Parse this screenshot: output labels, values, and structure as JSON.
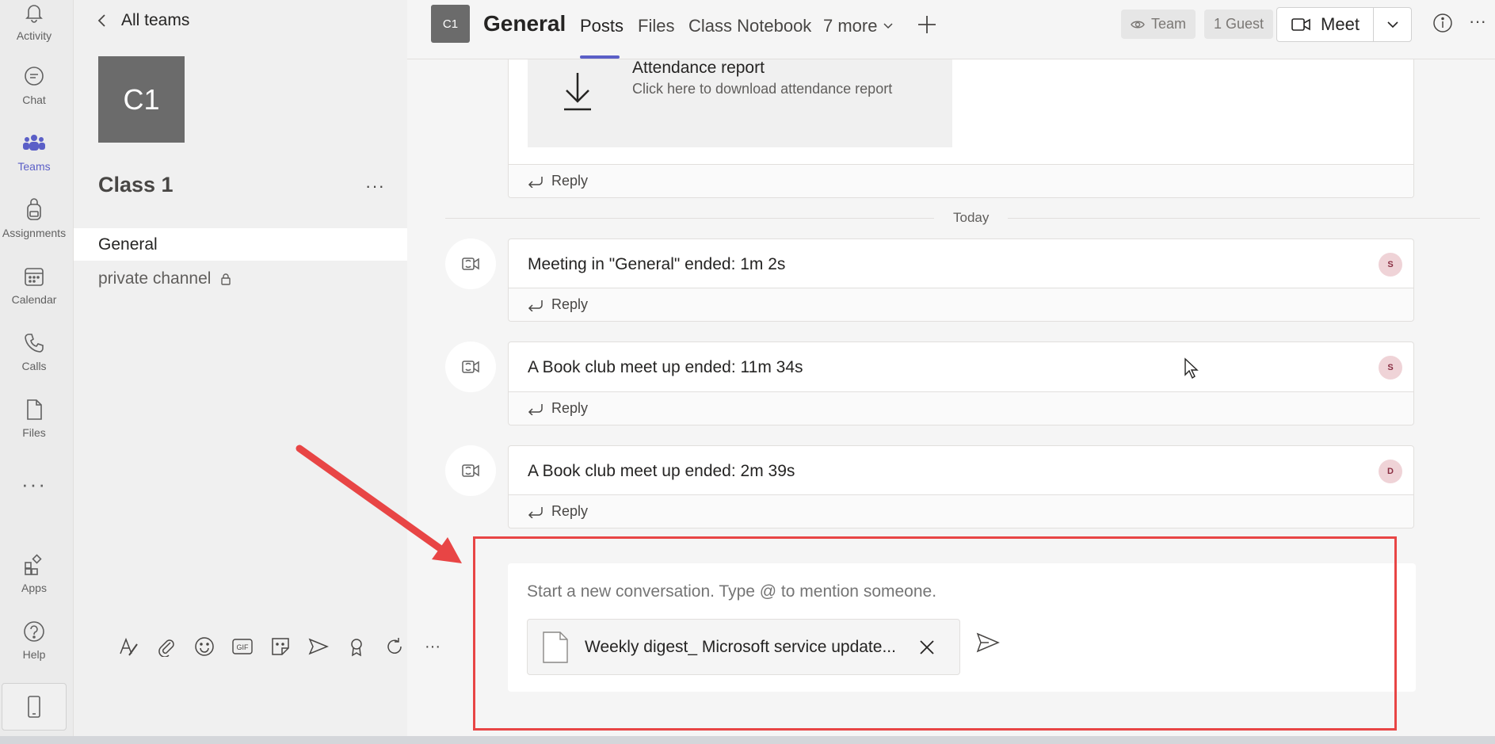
{
  "appbar": {
    "items": [
      {
        "label": "Activity",
        "icon": "bell-icon"
      },
      {
        "label": "Chat",
        "icon": "chat-icon"
      },
      {
        "label": "Teams",
        "icon": "teams-icon"
      },
      {
        "label": "Assignments",
        "icon": "backpack-icon"
      },
      {
        "label": "Calendar",
        "icon": "calendar-icon"
      },
      {
        "label": "Calls",
        "icon": "phone-icon"
      },
      {
        "label": "Files",
        "icon": "file-icon"
      }
    ],
    "more": "···",
    "bottom_items": [
      {
        "label": "Apps",
        "icon": "apps-icon"
      },
      {
        "label": "Help",
        "icon": "help-icon"
      }
    ],
    "active_color": "#5b5fc7"
  },
  "teampanel": {
    "back_label": "All teams",
    "team_initials": "C1",
    "team_name": "Class 1",
    "more": "···",
    "channels": [
      {
        "name": "General"
      },
      {
        "name": "private channel"
      }
    ]
  },
  "header": {
    "channel_initials": "C1",
    "channel_name": "General",
    "tabs": [
      "Posts",
      "Files",
      "Class Notebook",
      "7 more"
    ],
    "team_badge": "Team",
    "guest_badge": "1 Guest",
    "meet_label": "Meet"
  },
  "feed": {
    "attendance": {
      "title": "Attendance report",
      "subtitle": "Click here to download attendance report"
    },
    "reply_label": "Reply",
    "date_divider": "Today",
    "posts": [
      {
        "title": "Meeting in \"General\" ended: 1m 2s",
        "avatar": "S"
      },
      {
        "title": "A Book club meet up ended: 11m 34s",
        "avatar": "S"
      },
      {
        "title": "A Book club meet up ended: 2m 39s",
        "avatar": "D"
      }
    ]
  },
  "compose": {
    "placeholder": "Start a new conversation. Type @ to mention someone.",
    "attachment": "Weekly digest_ Microsoft service update..."
  },
  "annotation_color": "#e84545"
}
